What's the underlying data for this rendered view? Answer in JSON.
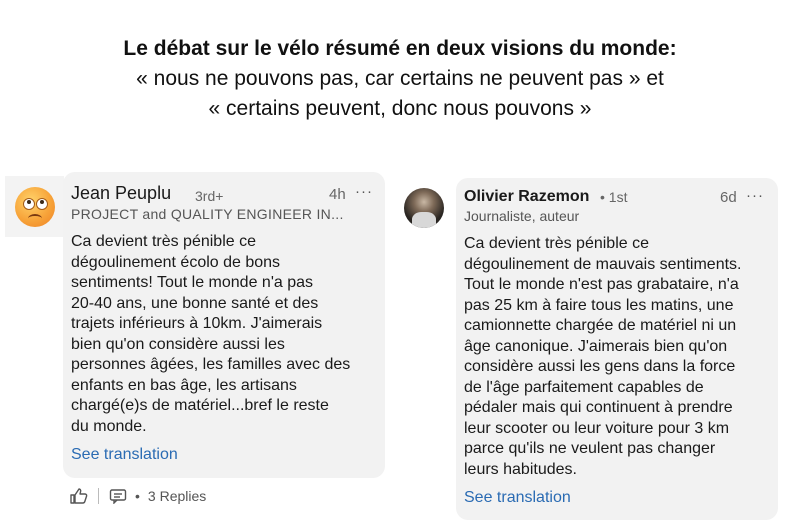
{
  "headline": {
    "line1": "Le débat sur le vélo résumé en deux visions du monde:",
    "line2": "« nous ne pouvons pas, car certains ne peuvent pas » et",
    "line3": "« certains peuvent, donc nous pouvons »"
  },
  "comment_left": {
    "author": "Jean Peuplu",
    "degree": "3rd+",
    "time": "4h",
    "more": "···",
    "subtitle": "PROJECT and QUALITY ENGINEER IN...",
    "body": "Ca devient très pénible ce\ndégoulinement écolo de bons\nsentiments! Tout le monde n'a pas\n20-40 ans, une bonne santé et des\ntrajets inférieurs à 10km. J'aimerais\nbien qu'on considère aussi les\npersonnes âgées, les familles avec des\nenfants en bas âge, les artisans\nchargé(e)s de matériel...bref le reste\ndu monde.",
    "translate": "See translation",
    "dot": "•",
    "replies": "3 Replies"
  },
  "comment_right": {
    "author": "Olivier Razemon",
    "degree": "• 1st",
    "time": "6d",
    "more": "···",
    "subtitle": "Journaliste, auteur",
    "body": "Ca devient très pénible ce\ndégoulinement de mauvais sentiments.\nTout le monde n'est pas grabataire, n'a\npas 25 km à faire tous les matins, une\ncamionnette chargée de matériel ni un\nâge canonique. J'aimerais bien qu'on\nconsidère aussi les gens dans la force\nde l'âge parfaitement capables de\npédaler mais qui continuent à prendre\nleur scooter ou leur voiture pour 3 km\nparce qu'ils ne veulent pas changer\nleurs habitudes.",
    "translate": "See translation"
  },
  "icons": [
    "sad-face-emoji-icon",
    "profile-photo",
    "thumbs-up-icon",
    "reply-icon",
    "more-icon"
  ],
  "colors": {
    "card_bg": "#f2f2f2",
    "link": "#2a6bb3",
    "text": "#1a1a1a",
    "muted": "#666666"
  }
}
